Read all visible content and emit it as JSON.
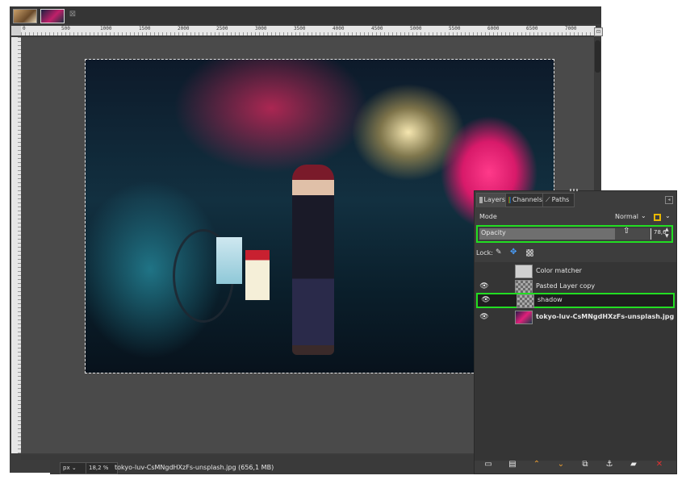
{
  "tabs": [
    {
      "name": "image-tab-1"
    },
    {
      "name": "image-tab-2"
    }
  ],
  "ruler": {
    "labels": [
      "0",
      "500",
      "1000",
      "1500",
      "2000",
      "2500",
      "3000",
      "3500",
      "4000",
      "4500",
      "5000",
      "5500",
      "6000",
      "6500",
      "7000"
    ]
  },
  "statusbar": {
    "unit": "px",
    "zoom": "18,2 %",
    "text": "tokyo-luv-CsMNgdHXzFs-unsplash.jpg (656,1 MB)"
  },
  "layers_panel": {
    "tabs": [
      {
        "label": "Layers",
        "icon": "layers-icon"
      },
      {
        "label": "Channels",
        "icon": "channels-icon"
      },
      {
        "label": "Paths",
        "icon": "paths-icon"
      }
    ],
    "mode_label": "Mode",
    "mode_value": "Normal",
    "opacity_label": "Opacity",
    "opacity_value": "78,6",
    "opacity_fraction": 0.786,
    "lock_label": "Lock:",
    "layers": [
      {
        "name": "Color matcher",
        "visible": false,
        "thumb": "gray",
        "bold": false
      },
      {
        "name": "Pasted Layer copy",
        "visible": true,
        "thumb": "check",
        "bold": false
      },
      {
        "name": "shadow",
        "visible": true,
        "thumb": "check",
        "bold": false,
        "selected": true
      },
      {
        "name": "tokyo-luv-CsMNgdHXzFs-unsplash.jpg",
        "visible": true,
        "thumb": "photo",
        "bold": true
      }
    ]
  },
  "colors": {
    "highlight": "#22dd22",
    "mode_switch": "#e8b800",
    "accent_orange": "#f0a030",
    "delete_red": "#e03030"
  }
}
